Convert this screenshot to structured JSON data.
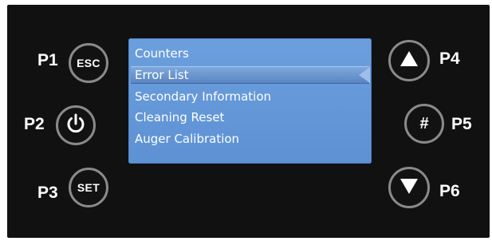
{
  "buttons": {
    "p1": {
      "label": "P1",
      "text": "ESC",
      "icon": "esc"
    },
    "p2": {
      "label": "P2",
      "icon": "power-icon"
    },
    "p3": {
      "label": "P3",
      "text": "SET",
      "icon": "set"
    },
    "p4": {
      "label": "P4",
      "icon": "triangle-up-icon"
    },
    "p5": {
      "label": "P5",
      "text": "#",
      "icon": "hash"
    },
    "p6": {
      "label": "P6",
      "icon": "triangle-down-icon"
    }
  },
  "screen": {
    "selected_index": 1,
    "items": [
      {
        "label": "Counters"
      },
      {
        "label": "Error List"
      },
      {
        "label": "Secondary Information"
      },
      {
        "label": "Cleaning Reset"
      },
      {
        "label": "Auger Calibration"
      }
    ]
  },
  "colors": {
    "panel": "#111111",
    "screen": "#6c9fdd",
    "button_ring": "#8a8a8a",
    "text": "#ffffff"
  }
}
